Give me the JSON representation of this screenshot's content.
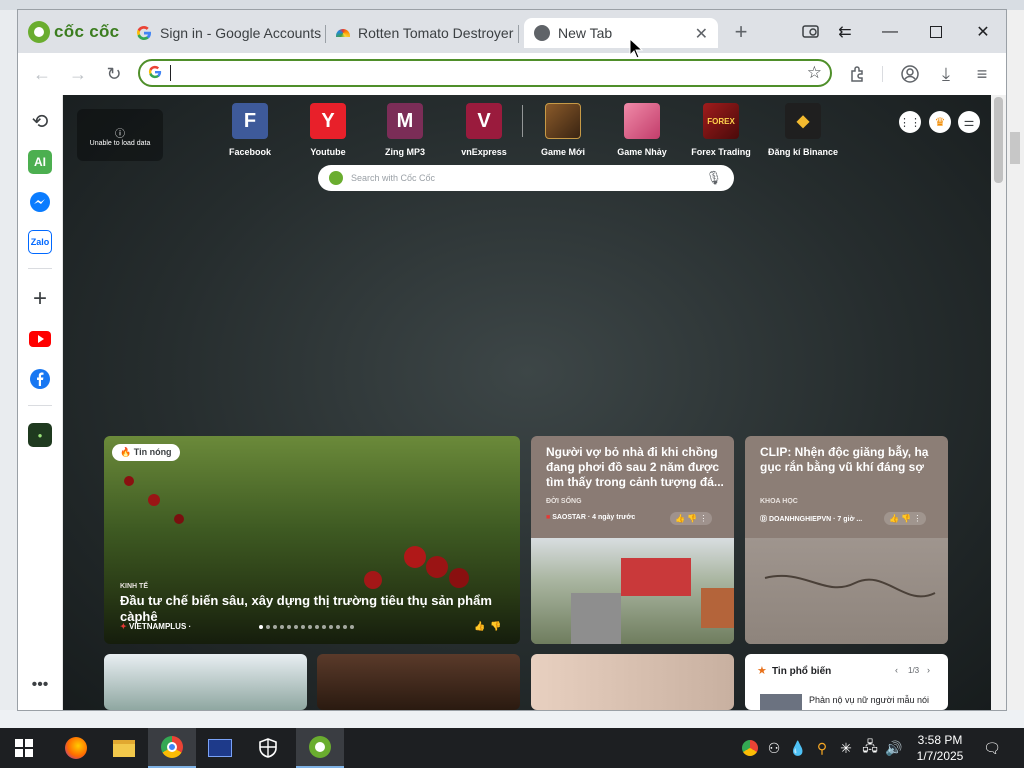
{
  "browser": {
    "name": "cốc cốc",
    "tabs": [
      {
        "title": "Sign in - Google Accounts"
      },
      {
        "title": "Rotten Tomato Destroyer"
      },
      {
        "title": "New Tab"
      }
    ],
    "omnibox_value": ""
  },
  "ntp": {
    "weather_text": "Unable to load data",
    "shortcuts": [
      {
        "label": "Facebook",
        "letter": "F",
        "color": "#3e5a9a"
      },
      {
        "label": "Youtube",
        "letter": "Y",
        "color": "#e8202a"
      },
      {
        "label": "Zing MP3",
        "letter": "M",
        "color": "#7b2d57"
      },
      {
        "label": "vnExpress",
        "letter": "V",
        "color": "#9a1b3d"
      },
      {
        "label": "Game Mới",
        "letter": "",
        "color": "#5a3a1a"
      },
      {
        "label": "Game Nhảy",
        "letter": "",
        "color": "#d4567b"
      },
      {
        "label": "Forex Trading",
        "letter": "",
        "color": "#7a1a1a"
      },
      {
        "label": "Đăng kí Binance",
        "letter": "",
        "color": "#1f1f1f"
      }
    ],
    "search_placeholder": "Search with Cốc Cốc",
    "featured": {
      "badge": "Tin nóng",
      "category": "KINH TẾ",
      "title": "Đầu tư chế biến sâu, xây dựng thị trường tiêu thụ sản phẩm càphê",
      "source": "VIETNAMPLUS ·"
    },
    "card1": {
      "title": "Người vợ bỏ nhà đi khi chồng đang phơi đồ sau 2 năm được tìm thấy trong cảnh tượng đá...",
      "category": "ĐỜI SỐNG",
      "source": "SAOSTAR · 4 ngày trước"
    },
    "card2": {
      "title": "CLIP: Nhện độc giăng bẫy, hạ gục rắn bằng vũ khí đáng sợ",
      "category": "KHOA HỌC",
      "source": "DOANHNGHIEPVN · 7 giờ ..."
    },
    "popular": {
      "title": "Tin phổ biến",
      "pager": "1/3",
      "item": "Phản nộ vụ nữ người mẫu nói"
    }
  },
  "taskbar": {
    "time": "3:58 PM",
    "date": "1/7/2025"
  },
  "colors": {
    "accent": "#4f8f2a",
    "brand_green": "#6aad2f"
  }
}
